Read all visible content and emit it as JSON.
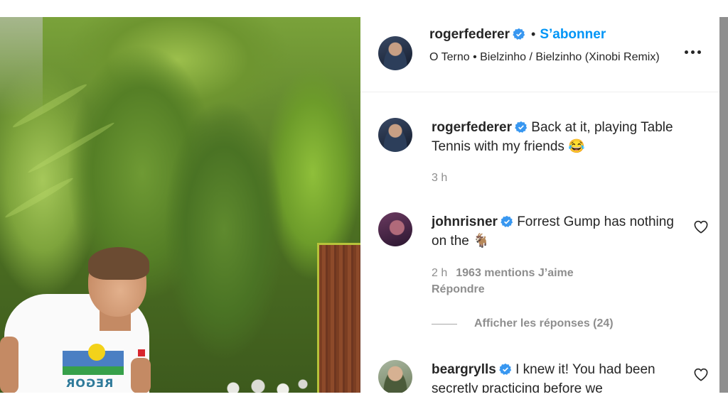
{
  "post": {
    "author": "rogerfederer",
    "follow_label": "S’abonner",
    "follow_separator": "•",
    "audio": "O Terno • Bielzinho / Bielzinho (Xinobi Remix)",
    "shirt_text": "REGOR"
  },
  "caption": {
    "author": "rogerfederer",
    "text": "Back at it, playing Table Tennis with my friends 😂",
    "time": "3 h"
  },
  "comments": [
    {
      "author": "johnrisner",
      "text": "Forrest Gump has nothing on the 🐐",
      "time": "2 h",
      "likes": "1963 mentions J’aime",
      "reply_label": "Répondre",
      "view_replies": "Afficher les réponses (24)"
    },
    {
      "author": "beargrylls",
      "text": "I knew it! You had been secretly practicing before we"
    }
  ],
  "colors": {
    "link": "#0095f6",
    "verified": "#3897f0",
    "meta": "#8e8e8e",
    "text": "#262626"
  }
}
